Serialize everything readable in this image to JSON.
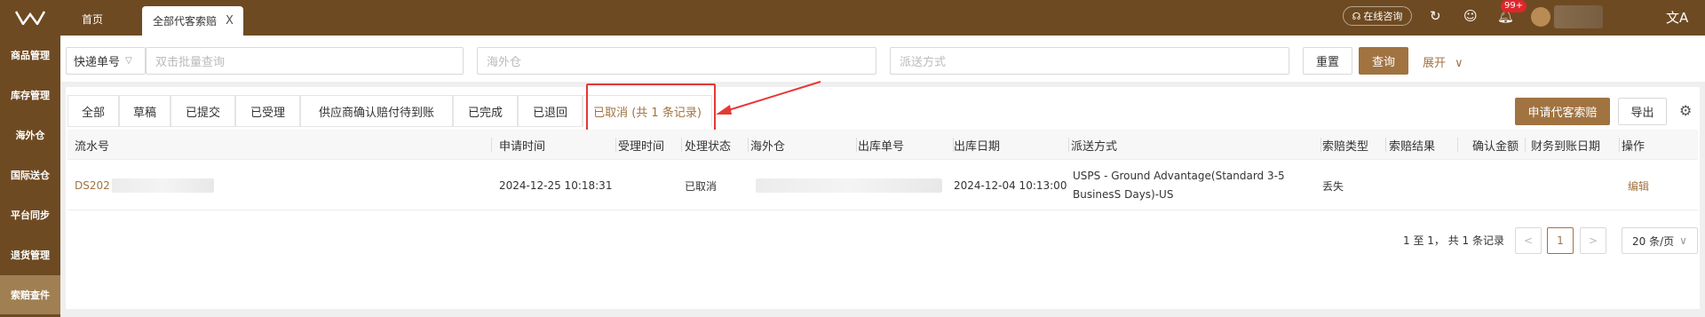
{
  "topbar": {
    "home_tab": "首页",
    "active_tab": "全部代客索赔",
    "close_symbol": "X",
    "consult_label": "在线咨询",
    "notification_badge": "99+"
  },
  "sidebar": {
    "items": [
      {
        "label": "商品管理"
      },
      {
        "label": "库存管理"
      },
      {
        "label": "海外仓"
      },
      {
        "label": "国际送仓"
      },
      {
        "label": "平台同步"
      },
      {
        "label": "退货管理"
      },
      {
        "label": "索赔查件",
        "active": true
      }
    ]
  },
  "filters": {
    "type_select": "快递单号",
    "batch_placeholder": "双击批量查询",
    "warehouse_placeholder": "海外仓",
    "shipping_placeholder": "派送方式",
    "reset_label": "重置",
    "query_label": "查询",
    "expand_label": "展开"
  },
  "status_tabs": [
    {
      "label": "全部"
    },
    {
      "label": "草稿"
    },
    {
      "label": "已提交"
    },
    {
      "label": "已受理"
    },
    {
      "label": "供应商确认赔付待到账"
    },
    {
      "label": "已完成"
    },
    {
      "label": "已退回"
    },
    {
      "label": "已取消 (共 1 条记录)",
      "active": true
    }
  ],
  "actions": {
    "apply_label": "申请代客索赔",
    "export_label": "导出"
  },
  "table": {
    "columns": [
      "流水号",
      "申请时间",
      "受理时间",
      "处理状态",
      "海外仓",
      "出库单号",
      "出库日期",
      "派送方式",
      "索赔类型",
      "索赔结果",
      "确认金额",
      "财务到账日期",
      "操作"
    ],
    "rows": [
      {
        "serial_prefix": "DS202",
        "apply_time": "2024-12-25 10:18:31",
        "accept_time": "",
        "status": "已取消",
        "outbound_date": "2024-12-04 10:13:00",
        "shipping_line1": "USPS - Ground Advantage(Standard 3-5",
        "shipping_line2": "BusinesS Days)-US",
        "claim_type": "丢失",
        "action": "编辑"
      }
    ]
  },
  "pagination": {
    "summary": "1 至 1， 共 1 条记录",
    "prev": "<",
    "current": "1",
    "next": ">",
    "page_size": "20 条/页"
  },
  "colors": {
    "brand_dark": "#6e4a22",
    "accent": "#a07341",
    "annotation_red": "#e53935"
  }
}
